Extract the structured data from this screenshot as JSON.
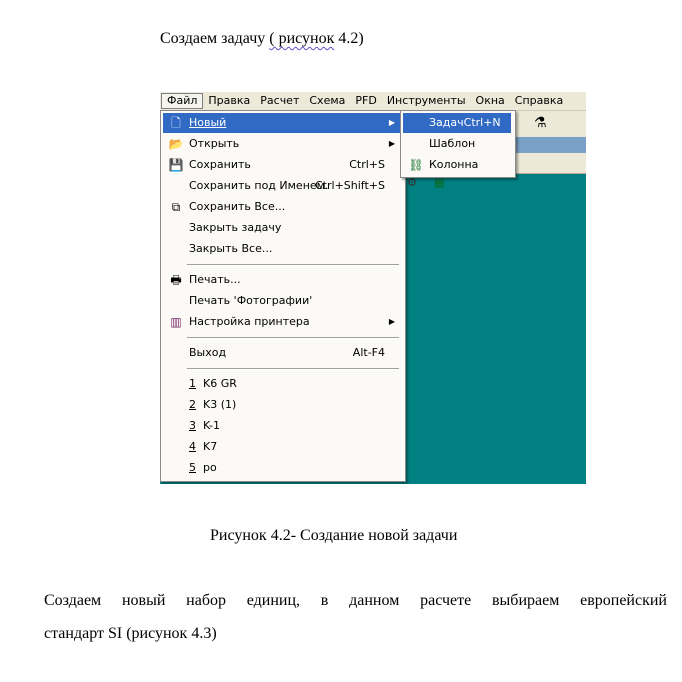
{
  "heading": {
    "before": "Создаем задачу ",
    "squiggle": "( рисунок",
    "after": " 4.2)"
  },
  "menubar": [
    "Файл",
    "Правка",
    "Расчет",
    "Схема",
    "PFD",
    "Инструменты",
    "Окна",
    "Справка"
  ],
  "file_menu": {
    "new": "Новый",
    "open": "Открыть",
    "save": "Сохранить",
    "save_shortcut": "Ctrl+S",
    "save_as": "Сохранить под Именем.",
    "save_as_shortcut": "Ctrl+Shift+S",
    "save_all": "Сохранить Все...",
    "close_task": "Закрыть задачу",
    "close_all": "Закрыть Все...",
    "print": "Печать...",
    "print_photos": "Печать 'Фотографии'",
    "printer_setup": "Настройка принтера",
    "exit": "Выход",
    "exit_shortcut": "Alt-F4",
    "recent": [
      {
        "num": "1",
        "label": "K6 GR"
      },
      {
        "num": "2",
        "label": "K3 (1)"
      },
      {
        "num": "3",
        "label": "K-1"
      },
      {
        "num": "4",
        "label": "K7"
      },
      {
        "num": "5",
        "label": "po"
      }
    ]
  },
  "submenu": {
    "task": "ЗадачCtrl+N",
    "template": "Шаблон",
    "column": "Колонна"
  },
  "caption": "Рисунок 4.2- Создание новой задачи",
  "paragraph": {
    "line1": "Создаем новый набор единиц, в данном расчете выбираем европейский",
    "line2": "стандарт SI (рисунок 4.3)"
  },
  "colors": {
    "workspace": "#008080",
    "highlight": "#316ac5",
    "menu": "#ece9d8"
  },
  "icons": [
    "new-doc-icon",
    "open-folder-icon",
    "save-disk-icon",
    "save-all-icon",
    "printer-icon",
    "printer-setup-icon",
    "column-icon",
    "flask-icon",
    "submenu-arrow-icon"
  ]
}
